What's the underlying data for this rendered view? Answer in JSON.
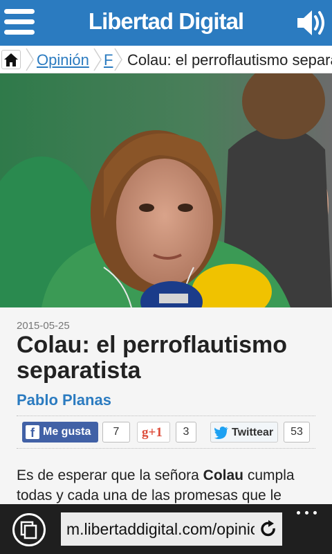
{
  "header": {
    "logo_text": "Libertad Digital",
    "brand_color": "#2b7bc0",
    "menu_icon": "hamburger-icon",
    "audio_icon": "speaker-icon"
  },
  "breadcrumb": {
    "home_icon": "home-icon",
    "section": "Opinión",
    "subsection": "F",
    "current": "Colau: el perroflautismo separatista"
  },
  "article": {
    "date": "2015-05-25",
    "title": "Colau: el perroflautismo separatista",
    "author": "Pablo Planas",
    "share": {
      "facebook_label": "Me gusta",
      "facebook_count": "7",
      "gplus_label": "+1",
      "gplus_count": "3",
      "twitter_label": "Twittear",
      "twitter_count": "53"
    },
    "intro_before": "Es de esperar que la señora ",
    "intro_bold": "Colau",
    "intro_after": " cumpla todas y cada una de las promesas que le"
  },
  "browser": {
    "url": "m.libertaddigital.com/opinion",
    "tabs_icon": "tabs-icon",
    "refresh_icon": "refresh-icon",
    "more_icon": "more-dots-icon"
  }
}
